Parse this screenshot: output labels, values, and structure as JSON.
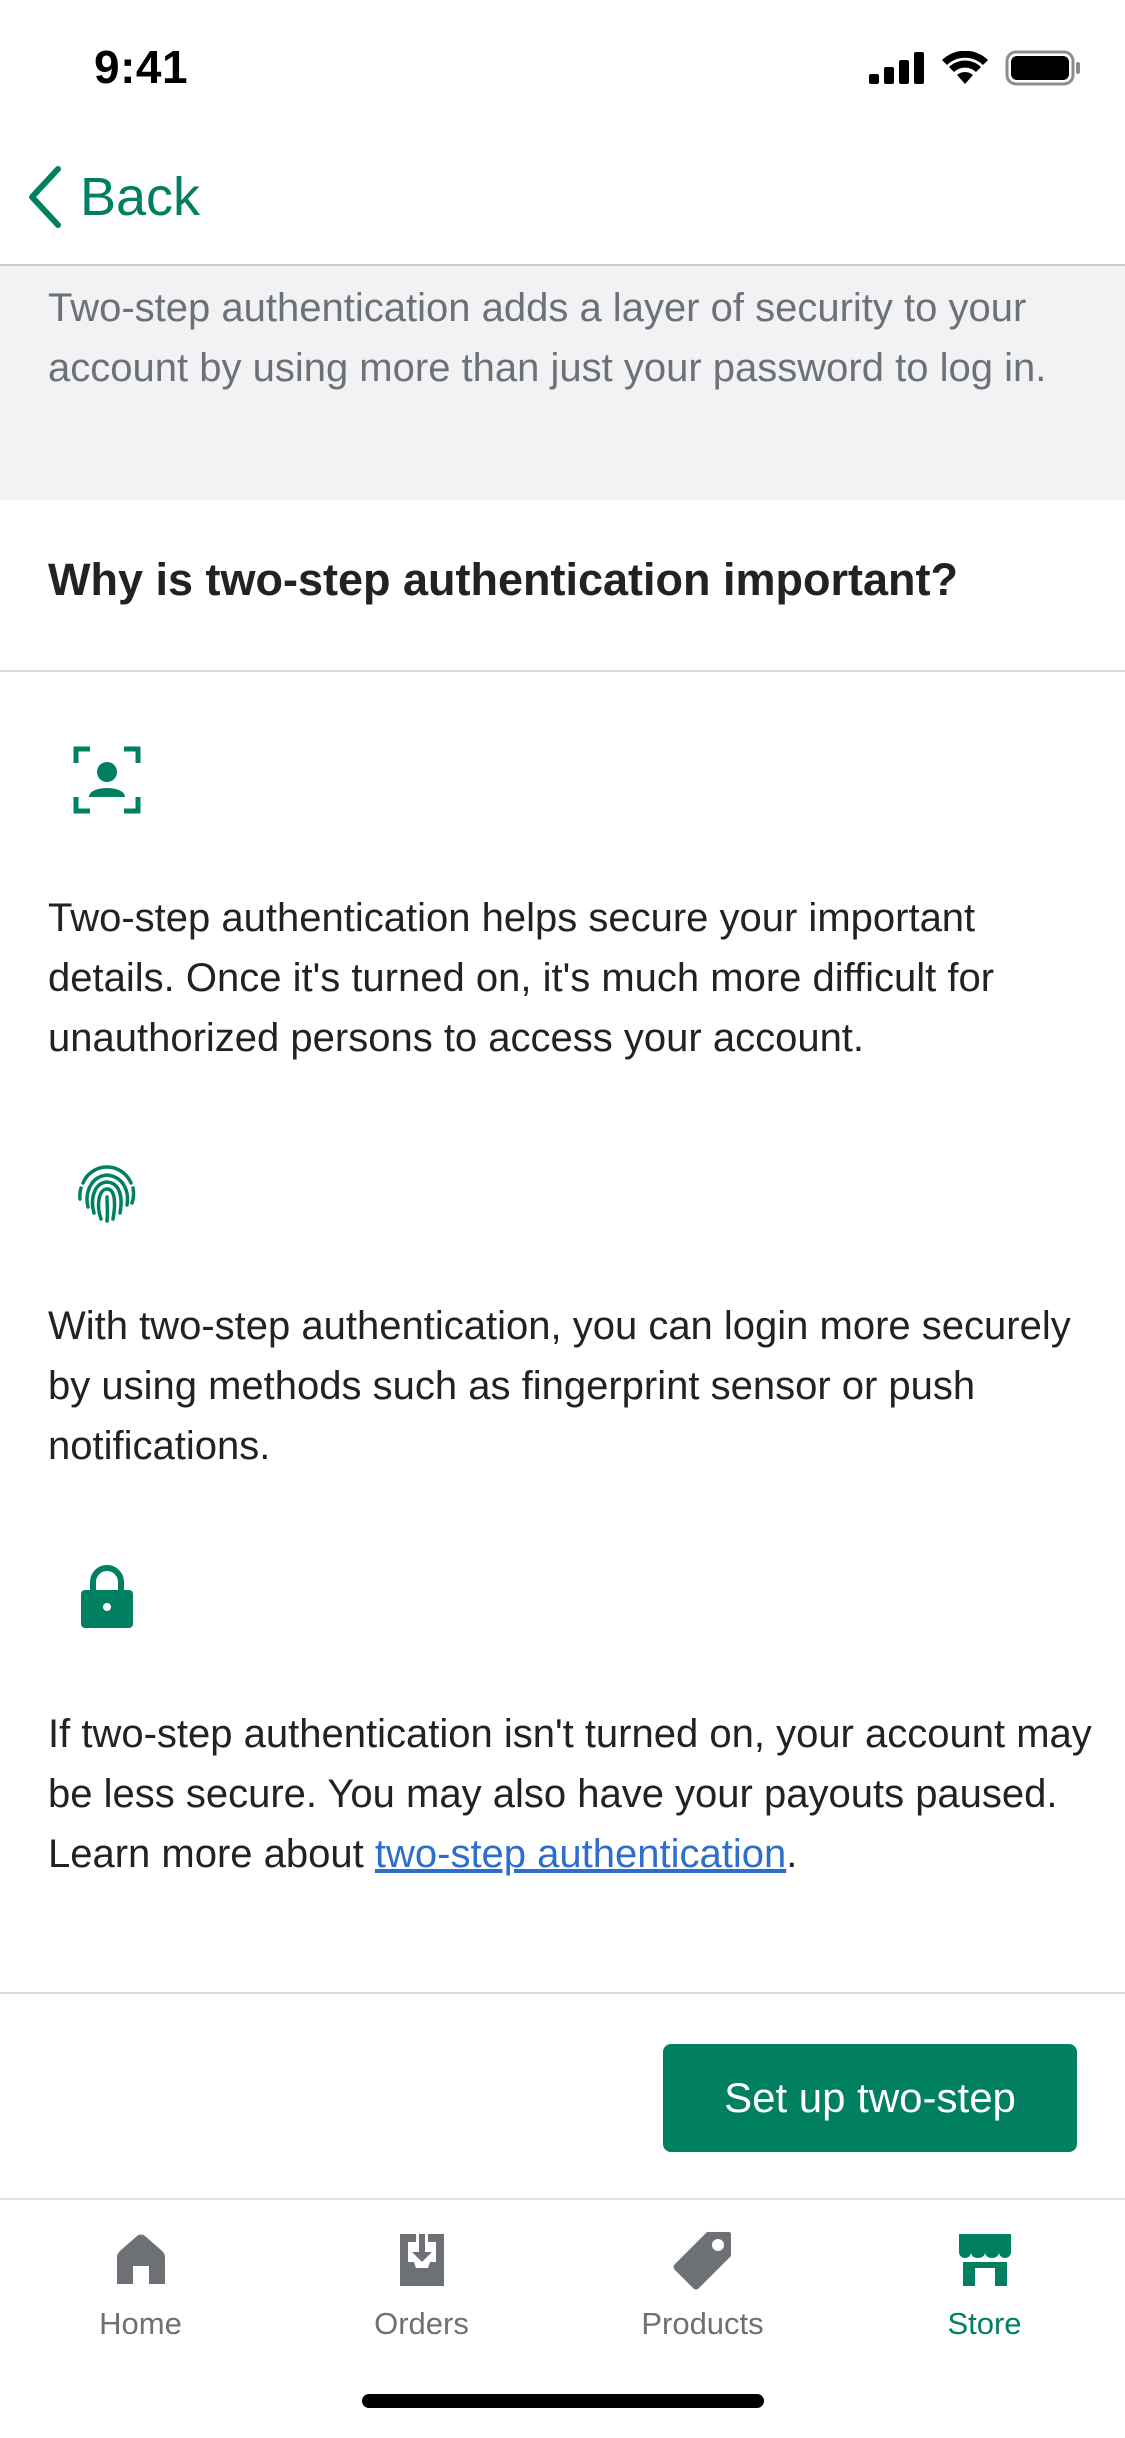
{
  "status_bar": {
    "time": "9:41"
  },
  "nav": {
    "back_label": "Back"
  },
  "intro": {
    "text": "Two-step authentication adds a layer of security to your account by using more than just your password to log in."
  },
  "heading": {
    "title": "Why is two-step authentication important?"
  },
  "features": [
    {
      "icon": "face-scan-icon",
      "text": "Two-step authentication helps secure your important details. Once it's turned on, it's much more difficult for unauthorized persons to access your account."
    },
    {
      "icon": "fingerprint-icon",
      "text": "With two-step authentication, you can login more securely by using methods such as fingerprint sensor or push notifications."
    },
    {
      "icon": "lock-icon",
      "text_before_link": "If two-step authentication isn't turned on, your account may be less secure. You may also have your payouts paused. Learn more about ",
      "link_text": "two-step authentication",
      "text_after_link": "."
    }
  ],
  "action": {
    "setup_label": "Set up two-step"
  },
  "tabs": [
    {
      "label": "Home",
      "icon": "home-icon",
      "active": false
    },
    {
      "label": "Orders",
      "icon": "orders-icon",
      "active": false
    },
    {
      "label": "Products",
      "icon": "products-tag-icon",
      "active": false
    },
    {
      "label": "Store",
      "icon": "store-icon",
      "active": true
    }
  ],
  "colors": {
    "brand_green": "#008060",
    "link_blue": "#2c6ecb",
    "muted_text": "#6d7175",
    "intro_background": "#f1f2f3"
  }
}
